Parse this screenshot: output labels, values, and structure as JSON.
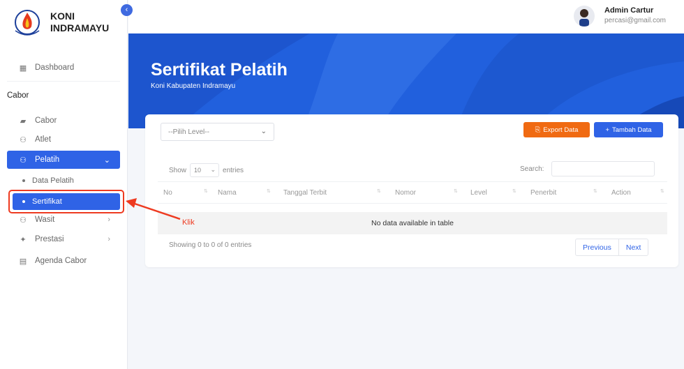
{
  "brand": {
    "line1": "KONI",
    "line2": "INDRAMAYU",
    "logo_text": "INDRAMAYU"
  },
  "sidebar": {
    "dashboard": "Dashboard",
    "section": "Cabor",
    "items": [
      {
        "label": "Cabor",
        "icon": "building-icon"
      },
      {
        "label": "Atlet",
        "icon": "users-icon"
      },
      {
        "label": "Pelatih",
        "icon": "users-icon",
        "active": true
      },
      {
        "label": "Wasit",
        "icon": "users-icon"
      },
      {
        "label": "Prestasi",
        "icon": "trophy-icon"
      },
      {
        "label": "Agenda Cabor",
        "icon": "calendar-icon"
      }
    ],
    "subitems": [
      {
        "label": "Data Pelatih"
      },
      {
        "label": "Sertifikat",
        "active": true
      }
    ]
  },
  "user": {
    "name": "Admin Cartur",
    "email": "percasi@gmail.com"
  },
  "hero": {
    "title": "Sertifikat Pelatih",
    "subtitle": "Koni Kabupaten Indramayu"
  },
  "filters": {
    "level_placeholder": "--Pilih Level--"
  },
  "buttons": {
    "export": "Export Data",
    "add": "Tambah Data"
  },
  "table": {
    "show": "Show",
    "entries_value": "10",
    "entries": "entries",
    "search_label": "Search:",
    "columns": [
      "No",
      "Nama",
      "Tanggal Terbit",
      "Nomor",
      "Level",
      "Penerbit",
      "Action"
    ],
    "empty": "No data available in table",
    "info": "Showing 0 to 0 of 0 entries",
    "prev": "Previous",
    "next": "Next"
  },
  "annotation": {
    "label": "Klik",
    "color": "#ee3a20"
  },
  "colors": {
    "primary": "#2f63e6",
    "export": "#f06a12",
    "hero": "#2160dd"
  }
}
